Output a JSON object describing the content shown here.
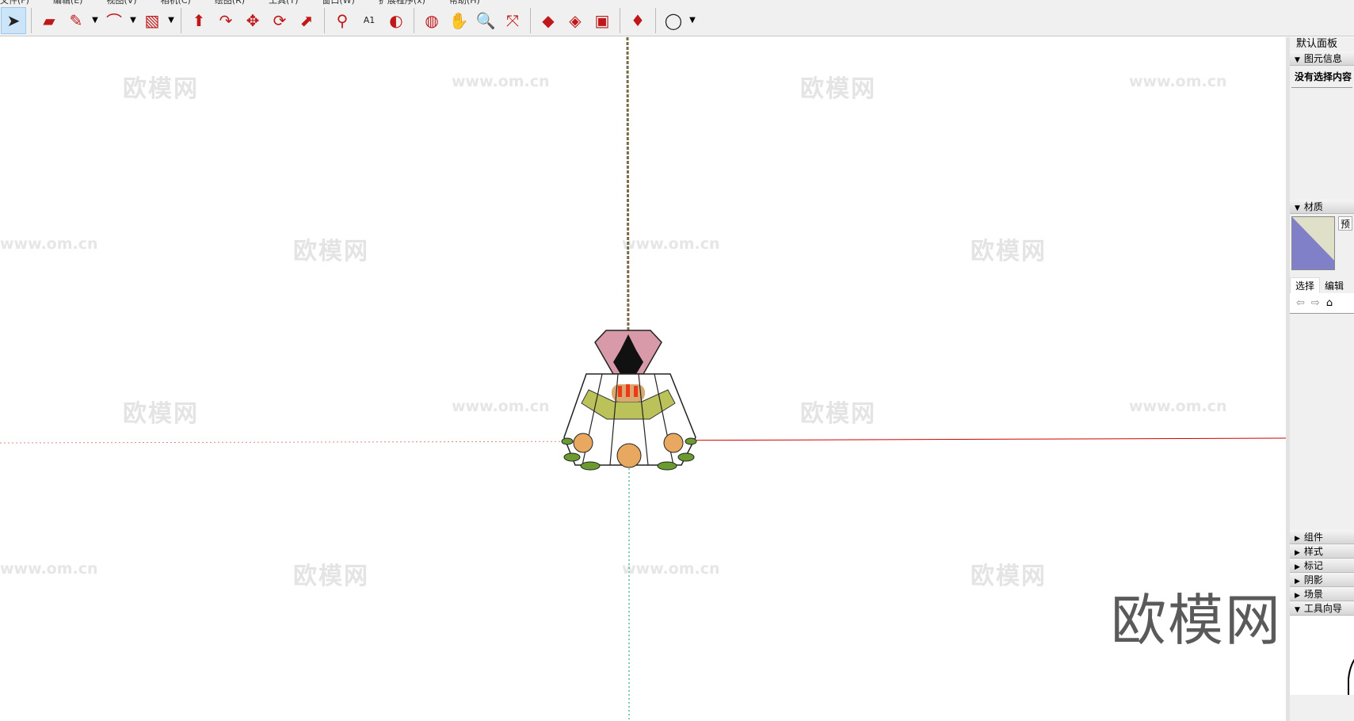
{
  "menu": [
    "文件(F)",
    "编辑(E)",
    "视图(V)",
    "相机(C)",
    "绘图(R)",
    "工具(T)",
    "窗口(W)",
    "扩展程序(x)",
    "帮助(H)"
  ],
  "toolbar": {
    "tools": [
      {
        "name": "select",
        "glyph": "➤",
        "active": true
      },
      {
        "sep": true
      },
      {
        "name": "eraser",
        "glyph": "▰"
      },
      {
        "name": "pencil",
        "glyph": "✎",
        "dd": true
      },
      {
        "name": "arc",
        "glyph": "⌒",
        "dd": true
      },
      {
        "name": "rectangle",
        "glyph": "▧",
        "dd": true
      },
      {
        "sep": true
      },
      {
        "name": "push-pull",
        "glyph": "⬆"
      },
      {
        "name": "follow-me",
        "glyph": "↷"
      },
      {
        "name": "move",
        "glyph": "✥"
      },
      {
        "name": "rotate",
        "glyph": "⟳"
      },
      {
        "name": "scale",
        "glyph": "⬈"
      },
      {
        "sep": true
      },
      {
        "name": "tape-measure",
        "glyph": "⚲"
      },
      {
        "name": "text",
        "glyph": "A1"
      },
      {
        "name": "paint-bucket",
        "glyph": "◐"
      },
      {
        "sep": true
      },
      {
        "name": "orbit",
        "glyph": "◍"
      },
      {
        "name": "pan",
        "glyph": "✋"
      },
      {
        "name": "zoom",
        "glyph": "🔍"
      },
      {
        "name": "zoom-extents",
        "glyph": "⤧"
      },
      {
        "sep": true
      },
      {
        "name": "3d-warehouse",
        "glyph": "◆"
      },
      {
        "name": "extension-warehouse",
        "glyph": "◈"
      },
      {
        "name": "send-to-layout",
        "glyph": "▣"
      },
      {
        "sep": true
      },
      {
        "name": "ruby-console",
        "glyph": "♦"
      },
      {
        "sep": true
      },
      {
        "name": "profile",
        "glyph": "◯",
        "dd": true
      }
    ]
  },
  "watermarks": {
    "logo": "欧模网",
    "url": "www.om.cn"
  },
  "big_watermark": "欧模网",
  "panel": {
    "title": "默认面板",
    "entity_info": {
      "label": "图元信息",
      "empty": "没有选择内容"
    },
    "materials": {
      "label": "材质",
      "preview_text": "预",
      "tab_select": "选择",
      "tab_edit": "编辑"
    },
    "collapsed": [
      "组件",
      "样式",
      "标记",
      "阴影",
      "场景"
    ],
    "instructor": {
      "label": "工具向导"
    }
  },
  "colors": {
    "accent_select": "#cce4f7",
    "axis_red": "#d40000",
    "axis_green": "#00a060",
    "material_a": "#8080c8",
    "material_b": "#e0e0c8"
  }
}
